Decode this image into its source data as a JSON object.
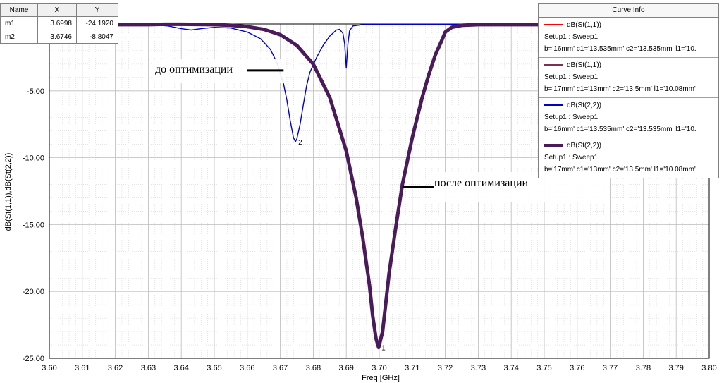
{
  "chart_data": {
    "type": "line",
    "xlabel": "Freq [GHz]",
    "ylabel": "dB(St(1,1)),dB(St(2,2))",
    "xlim": [
      3.6,
      3.8
    ],
    "ylim": [
      -25,
      0
    ],
    "x_ticks": [
      "3.60",
      "3.61",
      "3.62",
      "3.63",
      "3.64",
      "3.65",
      "3.66",
      "3.67",
      "3.68",
      "3.69",
      "3.70",
      "3.71",
      "3.72",
      "3.73",
      "3.74",
      "3.75",
      "3.76",
      "3.77",
      "3.78",
      "3.79",
      "3.80"
    ],
    "y_ticks": [
      {
        "value": -5,
        "label": "-5.00"
      },
      {
        "value": -10,
        "label": "-10.00"
      },
      {
        "value": -15,
        "label": "-15.00"
      },
      {
        "value": -20,
        "label": "-20.00"
      },
      {
        "value": -25,
        "label": "-25.00"
      }
    ],
    "grid": true,
    "series": [
      {
        "name": "dB(St(1,1))",
        "color": "#0000cc",
        "style": "thin",
        "x": [
          3.6,
          3.63,
          3.636,
          3.64,
          3.643,
          3.646,
          3.65,
          3.655,
          3.66,
          3.664,
          3.667,
          3.669,
          3.671,
          3.672,
          3.673,
          3.674,
          3.6746,
          3.675,
          3.676,
          3.677,
          3.678,
          3.679,
          3.681,
          3.683,
          3.685,
          3.687,
          3.688,
          3.689,
          3.6895,
          3.69,
          3.6905,
          3.691,
          3.692,
          3.695,
          3.7,
          3.72,
          3.75,
          3.8
        ],
        "y": [
          -0.05,
          -0.05,
          -0.15,
          -0.35,
          -0.45,
          -0.35,
          -0.25,
          -0.3,
          -0.6,
          -1.1,
          -1.9,
          -2.9,
          -4.5,
          -5.7,
          -7.2,
          -8.5,
          -8.8047,
          -8.6,
          -7.5,
          -6.0,
          -4.6,
          -3.6,
          -2.5,
          -1.6,
          -0.9,
          -0.45,
          -0.4,
          -0.7,
          -1.5,
          -3.3,
          -1.5,
          -0.5,
          -0.15,
          -0.05,
          -0.02,
          -0.02,
          -0.02,
          -0.02
        ]
      },
      {
        "name": "dB(St(2,2))",
        "color": "#4a1a5a",
        "style": "thick",
        "x": [
          3.6,
          3.63,
          3.635,
          3.64,
          3.645,
          3.65,
          3.655,
          3.66,
          3.665,
          3.67,
          3.675,
          3.68,
          3.685,
          3.69,
          3.693,
          3.695,
          3.697,
          3.698,
          3.699,
          3.6998,
          3.701,
          3.702,
          3.703,
          3.705,
          3.707,
          3.71,
          3.713,
          3.715,
          3.717,
          3.719,
          3.72,
          3.722,
          3.725,
          3.73,
          3.75,
          3.8
        ],
        "y": [
          -0.05,
          -0.05,
          -0.02,
          -0.02,
          -0.03,
          -0.05,
          -0.1,
          -0.2,
          -0.4,
          -0.8,
          -1.6,
          -3.0,
          -5.5,
          -9.5,
          -13.0,
          -16.0,
          -19.5,
          -21.8,
          -23.5,
          -24.192,
          -23.0,
          -20.8,
          -18.6,
          -15.2,
          -12.0,
          -8.5,
          -5.5,
          -3.8,
          -2.3,
          -1.2,
          -0.6,
          -0.25,
          -0.1,
          -0.05,
          -0.05,
          -0.05
        ]
      }
    ],
    "markers": [
      {
        "name": "m1",
        "x": 3.6998,
        "y": -24.192,
        "label": "1"
      },
      {
        "name": "m2",
        "x": 3.6746,
        "y": -8.8047,
        "label": "2"
      }
    ],
    "annotations": [
      {
        "text": "до оптимизации",
        "target_x": 3.671,
        "target_y": -3.5
      },
      {
        "text": "после оптимизации",
        "target_x": 3.707,
        "target_y": -12.2
      }
    ]
  },
  "marker_table": {
    "headers": [
      "Name",
      "X",
      "Y"
    ],
    "rows": [
      [
        "m1",
        "3.6998",
        "-24.1920"
      ],
      [
        "m2",
        "3.6746",
        "-8.8047"
      ]
    ]
  },
  "curve_info": {
    "title": "Curve Info",
    "entries": [
      {
        "name": "dB(St(1,1))",
        "color": "#ff0000",
        "thick": false,
        "setup": "Setup1 : Sweep1",
        "params": "b='16mm' c1='13.535mm' c2='13.535mm' l1='10."
      },
      {
        "name": "dB(St(1,1))",
        "color": "#7a3050",
        "thick": false,
        "setup": "Setup1 : Sweep1",
        "params": "b='17mm' c1='13mm' c2='13.5mm' l1='10.08mm'"
      },
      {
        "name": "dB(St(2,2))",
        "color": "#0000cc",
        "thick": false,
        "setup": "Setup1 : Sweep1",
        "params": "b='16mm' c1='13.535mm' c2='13.535mm' l1='10."
      },
      {
        "name": "dB(St(2,2))",
        "color": "#4a1a5a",
        "thick": true,
        "setup": "Setup1 : Sweep1",
        "params": "b='17mm' c1='13mm' c2='13.5mm' l1='10.08mm'"
      }
    ]
  }
}
